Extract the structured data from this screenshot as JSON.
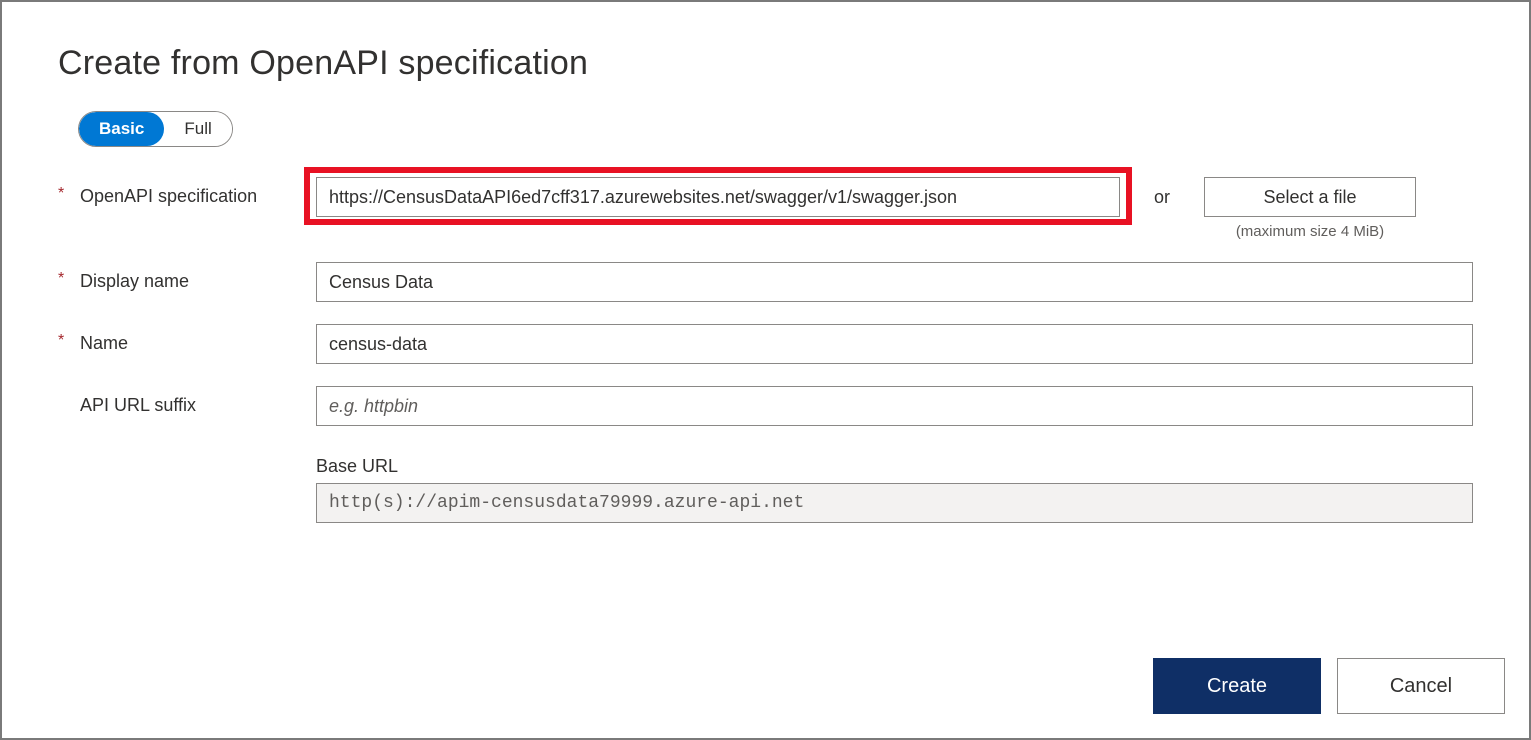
{
  "title": "Create from OpenAPI specification",
  "toggle": {
    "basic": "Basic",
    "full": "Full"
  },
  "fields": {
    "openapi": {
      "label": "OpenAPI specification",
      "value": "https://CensusDataAPI6ed7cff317.azurewebsites.net/swagger/v1/swagger.json",
      "or": "or",
      "select_file": "Select a file",
      "max_size": "(maximum size 4 MiB)"
    },
    "display_name": {
      "label": "Display name",
      "value": "Census Data"
    },
    "name": {
      "label": "Name",
      "value": "census-data"
    },
    "suffix": {
      "label": "API URL suffix",
      "value": "",
      "placeholder": "e.g. httpbin"
    },
    "base_url": {
      "label": "Base URL",
      "value": "http(s)://apim-censusdata79999.azure-api.net"
    }
  },
  "buttons": {
    "create": "Create",
    "cancel": "Cancel"
  }
}
